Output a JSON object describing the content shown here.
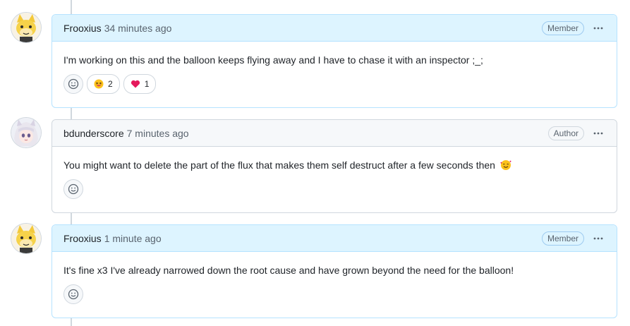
{
  "comments": [
    {
      "author": "Frooxius",
      "time": "34 minutes ago",
      "role": "Member",
      "body": "I'm working on this and the balloon keeps flying away and I have to chase it with an inspector ;_;",
      "reactions": [
        {
          "icon": "grinning-squinting-face-icon",
          "count": "2"
        },
        {
          "icon": "heart-icon",
          "count": "1"
        }
      ]
    },
    {
      "author": "bdunderscore",
      "time": "7 minutes ago",
      "role": "Author",
      "body": "You might want to delete the part of the flux that makes them self destruct after a few seconds then",
      "body_emoji": "smiling-face-with-hearts-icon",
      "reactions": []
    },
    {
      "author": "Frooxius",
      "time": "1 minute ago",
      "role": "Member",
      "body": "It's fine x3 I've already narrowed down the root cause and have grown beyond the need for the balloon!",
      "reactions": []
    }
  ],
  "colors": {
    "member_header": "#ddf4ff",
    "member_border": "#b6e3ff",
    "default_header": "#f6f8fa",
    "default_border": "#d0d7de",
    "heart": "#e5195c"
  }
}
